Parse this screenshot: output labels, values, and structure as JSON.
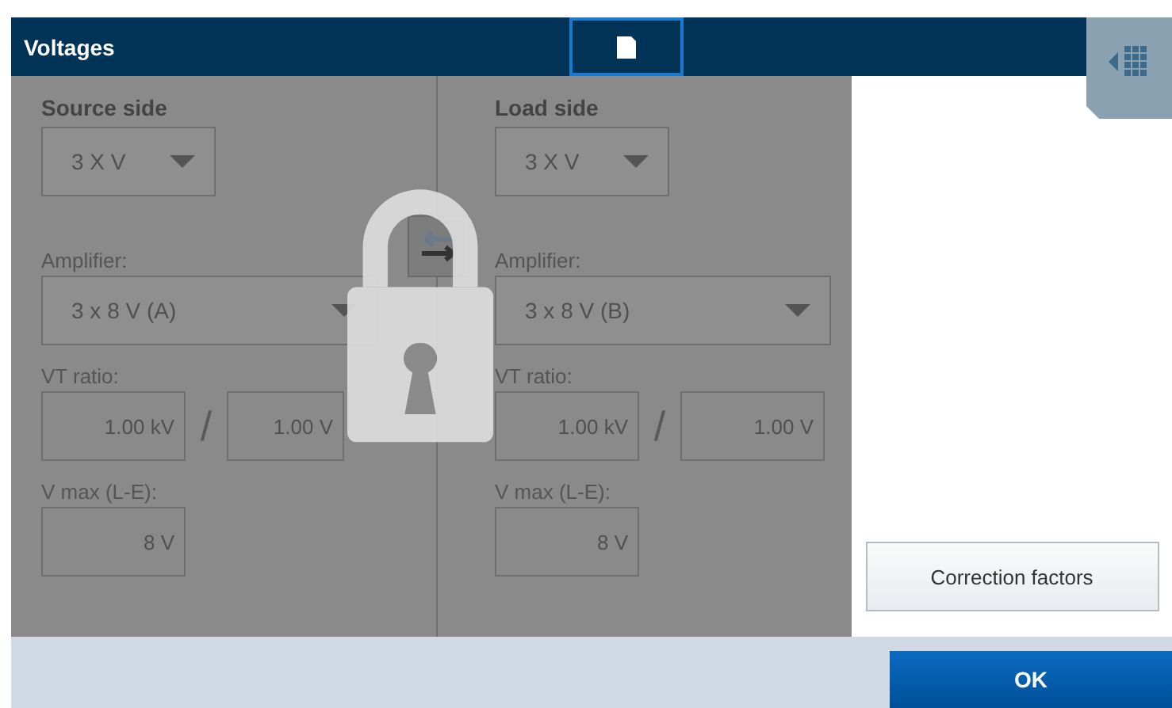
{
  "window": {
    "title": "Voltages"
  },
  "locked": true,
  "sides": [
    {
      "title": "Source side",
      "mode": "3 X V",
      "amplifier_label": "Amplifier:",
      "amplifier": "3 x 8 V (A)",
      "vt_label": "VT ratio:",
      "vt_primary": "1.00 kV",
      "vt_separator": "/",
      "vt_secondary": "1.00 V",
      "vmax_label": "V max (L-E):",
      "vmax": "8 V"
    },
    {
      "title": "Load side",
      "mode": "3 X V",
      "amplifier_label": "Amplifier:",
      "amplifier": "3 x 8 V (B)",
      "vt_label": "VT ratio:",
      "vt_primary": "1.00 kV",
      "vt_separator": "/",
      "vt_secondary": "1.00 V",
      "vmax_label": "V max (L-E):",
      "vmax": "8 V"
    }
  ],
  "buttons": {
    "correction": "Correction factors",
    "ok": "OK"
  }
}
